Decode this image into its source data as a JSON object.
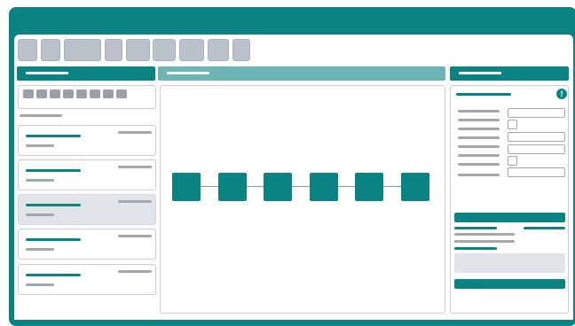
{
  "colors": {
    "primary": "#0a8382",
    "secondary_header": "#6db5b3",
    "placeholder_gray": "#a3a8ad",
    "toolbar_button": "#b9c1ca",
    "selected_card": "#e1e5e9"
  },
  "toolbar": {
    "button_count": 9
  },
  "left_panel": {
    "filter_chip_count": 8,
    "cards": [
      {
        "selected": false
      },
      {
        "selected": false
      },
      {
        "selected": true
      },
      {
        "selected": false
      },
      {
        "selected": false
      }
    ]
  },
  "canvas": {
    "node_count": 6,
    "connector_count": 5
  },
  "right_panel": {
    "warning_icon": "exclamation-circle-icon",
    "warning_glyph": "!",
    "form_rows": [
      {
        "control": "text-input"
      },
      {
        "control": "checkbox"
      },
      {
        "control": "text-input"
      },
      {
        "control": "text-input"
      },
      {
        "control": "checkbox"
      },
      {
        "control": "text-input"
      }
    ]
  }
}
